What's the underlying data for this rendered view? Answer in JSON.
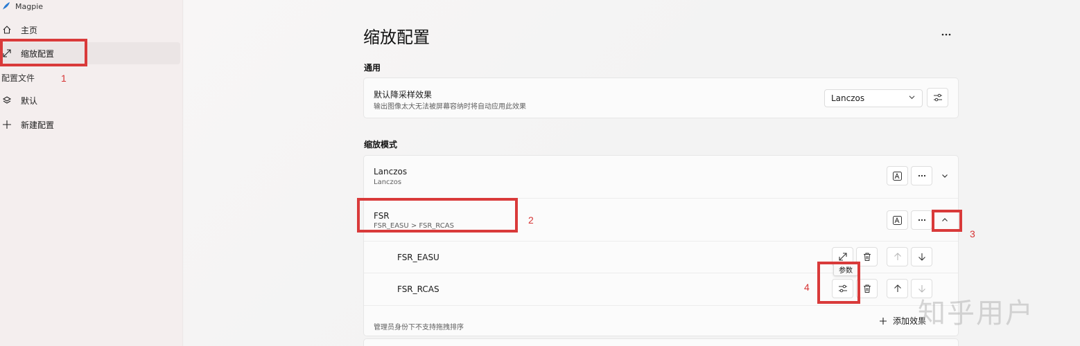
{
  "app": {
    "title": "Magpie"
  },
  "sidebar": {
    "items": [
      {
        "label": "主页",
        "icon": "home-icon"
      },
      {
        "label": "缩放配置",
        "icon": "scale-icon"
      }
    ],
    "profiles_header": "配置文件",
    "profiles": [
      {
        "label": "默认",
        "icon": "layers-icon"
      },
      {
        "label": "新建配置",
        "icon": "plus-icon"
      }
    ]
  },
  "page": {
    "title": "缩放配置",
    "general_header": "通用",
    "default_downscale": {
      "title": "默认降采样效果",
      "subtitle": "输出图像太大无法被屏幕容纳时将自动应用此效果",
      "selected": "Lanczos"
    },
    "modes_header": "缩放模式",
    "modes": [
      {
        "name": "Lanczos",
        "chain": "Lanczos"
      },
      {
        "name": "FSR",
        "chain": "FSR_EASU > FSR_RCAS",
        "effects": [
          {
            "name": "FSR_EASU"
          },
          {
            "name": "FSR_RCAS"
          }
        ]
      }
    ],
    "tooltip": "参数",
    "drag_note": "管理员身份下不支持拖拽排序",
    "add_effect": "添加效果"
  },
  "annotations": [
    "1",
    "2",
    "3",
    "4"
  ],
  "watermark": "知乎用户",
  "colors": {
    "annotation": "#d93a3a",
    "sidebar_bg": "#f4eeee",
    "card_bg": "#fbfbfb"
  }
}
